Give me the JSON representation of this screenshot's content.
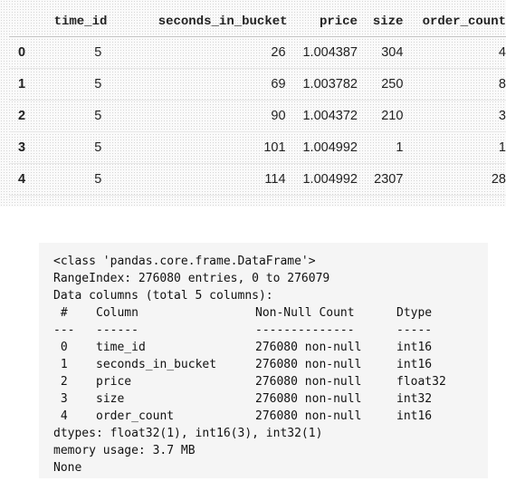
{
  "dataframe": {
    "columns": [
      "",
      "time_id",
      "seconds_in_bucket",
      "price",
      "size",
      "order_count"
    ],
    "rows": [
      {
        "index": "0",
        "time_id": "5",
        "seconds_in_bucket": "26",
        "price": "1.004387",
        "size": "304",
        "order_count": "4"
      },
      {
        "index": "1",
        "time_id": "5",
        "seconds_in_bucket": "69",
        "price": "1.003782",
        "size": "250",
        "order_count": "8"
      },
      {
        "index": "2",
        "time_id": "5",
        "seconds_in_bucket": "90",
        "price": "1.004372",
        "size": "210",
        "order_count": "3"
      },
      {
        "index": "3",
        "time_id": "5",
        "seconds_in_bucket": "101",
        "price": "1.004992",
        "size": "1",
        "order_count": "1"
      },
      {
        "index": "4",
        "time_id": "5",
        "seconds_in_bucket": "114",
        "price": "1.004992",
        "size": "2307",
        "order_count": "28"
      }
    ]
  },
  "info": {
    "class_line": "<class 'pandas.core.frame.DataFrame'>",
    "range_index": "RangeIndex: 276080 entries, 0 to 276079",
    "data_columns": "Data columns (total 5 columns):",
    "header": {
      "num": " #",
      "column": "Column",
      "non_null": "Non-Null Count",
      "dtype": "Dtype"
    },
    "separator": {
      "num": "---",
      "column": "------",
      "non_null": "--------------",
      "dtype": "-----"
    },
    "columns": [
      {
        "num": " 0",
        "column": "time_id",
        "non_null": "276080 non-null",
        "dtype": "int16"
      },
      {
        "num": " 1",
        "column": "seconds_in_bucket",
        "non_null": "276080 non-null",
        "dtype": "int16"
      },
      {
        "num": " 2",
        "column": "price",
        "non_null": "276080 non-null",
        "dtype": "float32"
      },
      {
        "num": " 3",
        "column": "size",
        "non_null": "276080 non-null",
        "dtype": "int32"
      },
      {
        "num": " 4",
        "column": "order_count",
        "non_null": "276080 non-null",
        "dtype": "int16"
      }
    ],
    "dtypes": "dtypes: float32(1), int16(3), int32(1)",
    "memory": "memory usage: 3.7 MB",
    "return_value": "None"
  }
}
